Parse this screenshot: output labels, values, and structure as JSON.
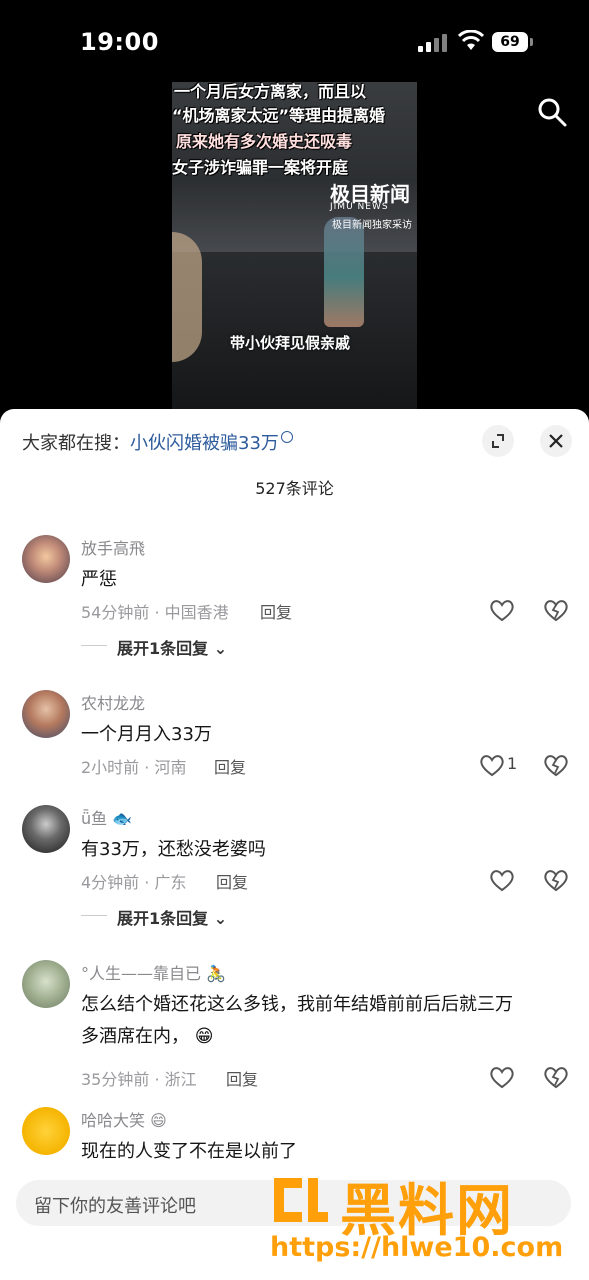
{
  "status_bar": {
    "time": "19:00",
    "battery": "69"
  },
  "video": {
    "captions": [
      "一个月后女方离家，而且以",
      "“机场离家太远”等理由提离婚",
      "原来她有多次婚史还吸毒",
      "女子涉诈骗罪一案将开庭"
    ],
    "news_logo": "极目新闻",
    "news_sub": "JIMU NEWS",
    "news_credit": "极目新闻独家采访",
    "subtitle": "带小伙拜见假亲戚"
  },
  "sheet": {
    "hot_prefix": "大家都在搜：",
    "hot_keyword": "小伙闪婚被骗33万",
    "comment_count": "527条评论"
  },
  "comments": [
    {
      "user": "放手高飛",
      "text": "严惩",
      "time_location": "54分钟前 · 中国香港",
      "reply": "回复",
      "likes": "",
      "expand": "展开1条回复"
    },
    {
      "user": "农村龙龙",
      "text": "一个月月入33万",
      "time_location": "2小时前 · 河南",
      "reply": "回复",
      "likes": "1",
      "expand": ""
    },
    {
      "user": "ǖ鱼",
      "text": "有33万，还愁没老婆吗",
      "time_location": "4分钟前 · 广东",
      "reply": "回复",
      "likes": "",
      "expand": "展开1条回复"
    },
    {
      "user": "°人生——靠自已",
      "text": "怎么结个婚还花这么多钱，我前年结婚前前后后就三万",
      "text2": "多酒席在内，",
      "time_location": "35分钟前 · 浙江",
      "reply": "回复",
      "likes": ""
    },
    {
      "user": "哈哈大笑",
      "text": "现在的人变了不在是以前了"
    }
  ],
  "input": {
    "placeholder": "留下你的友善评论吧"
  },
  "watermark": {
    "title": "黑料网",
    "url": "https://hlwe10.com"
  },
  "colors": {
    "keyword": "#2d5b9c",
    "watermark": "#ff9f0a"
  },
  "icons": [
    "search-icon",
    "expand-icon",
    "close-icon",
    "heart-icon",
    "broken-heart-icon",
    "chevron-down-icon"
  ]
}
